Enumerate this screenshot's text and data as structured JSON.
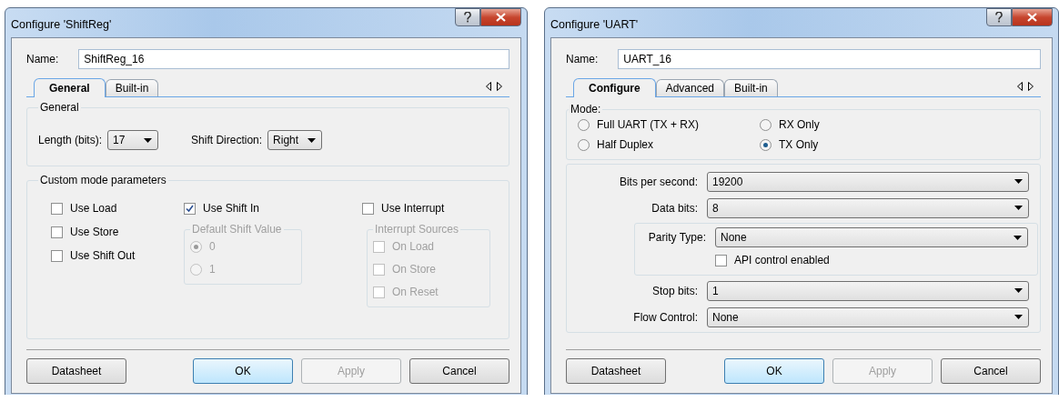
{
  "dialogs": [
    {
      "kind": "shiftreg",
      "title": "Configure 'ShiftReg'",
      "name_label": "Name:",
      "name_value": "ShiftReg_16",
      "tabs": [
        {
          "label": "General",
          "selected": true
        },
        {
          "label": "Built-in",
          "selected": false
        }
      ],
      "general": {
        "title": "General",
        "fields": [
          {
            "label": "Length (bits):",
            "value": "17"
          },
          {
            "label": "Shift Direction:",
            "value": "Right"
          }
        ]
      },
      "custom": {
        "title": "Custom mode parameters",
        "options": [
          {
            "label": "Use Load",
            "checked": false
          },
          {
            "label": "Use Store",
            "checked": false
          },
          {
            "label": "Use Shift Out",
            "checked": false
          }
        ],
        "shift_in": {
          "label": "Use Shift In",
          "checked": true
        },
        "default_shift": {
          "title": "Default Shift Value",
          "disabled": true,
          "options": [
            {
              "label": "0",
              "selected": true
            },
            {
              "label": "1",
              "selected": false
            }
          ]
        },
        "interrupt": {
          "label": "Use Interrupt",
          "checked": false
        },
        "interrupt_sources": {
          "title": "Interrupt Sources",
          "disabled": true,
          "options": [
            {
              "label": "On Load",
              "checked": false
            },
            {
              "label": "On Store",
              "checked": false
            },
            {
              "label": "On Reset",
              "checked": false
            }
          ]
        }
      },
      "buttons": [
        {
          "label": "Datasheet",
          "default": false,
          "disabled": false
        },
        {
          "label": "OK",
          "default": true,
          "disabled": false
        },
        {
          "label": "Apply",
          "default": false,
          "disabled": true
        },
        {
          "label": "Cancel",
          "default": false,
          "disabled": false
        }
      ]
    },
    {
      "kind": "uart",
      "title": "Configure 'UART'",
      "name_label": "Name:",
      "name_value": "UART_16",
      "tabs": [
        {
          "label": "Configure",
          "selected": true
        },
        {
          "label": "Advanced",
          "selected": false
        },
        {
          "label": "Built-in",
          "selected": false
        }
      ],
      "mode": {
        "title": "Mode:",
        "options": [
          {
            "label": "Full UART (TX + RX)",
            "selected": false
          },
          {
            "label": "RX Only",
            "selected": false
          },
          {
            "label": "Half Duplex",
            "selected": false
          },
          {
            "label": "TX Only",
            "selected": true
          }
        ]
      },
      "settings": [
        {
          "kind": "select",
          "label": "Bits per second:",
          "value": "19200"
        },
        {
          "kind": "select",
          "label": "Data bits:",
          "value": "8"
        },
        {
          "kind": "parity",
          "label": "Parity Type:",
          "value": "None",
          "checkbox": {
            "label": "API control enabled",
            "checked": false
          }
        },
        {
          "kind": "select",
          "label": "Stop bits:",
          "value": "1"
        },
        {
          "kind": "select",
          "label": "Flow Control:",
          "value": "None"
        }
      ],
      "buttons": [
        {
          "label": "Datasheet",
          "default": false,
          "disabled": false
        },
        {
          "label": "OK",
          "default": true,
          "disabled": false
        },
        {
          "label": "Apply",
          "default": false,
          "disabled": true
        },
        {
          "label": "Cancel",
          "default": false,
          "disabled": false
        }
      ]
    }
  ]
}
